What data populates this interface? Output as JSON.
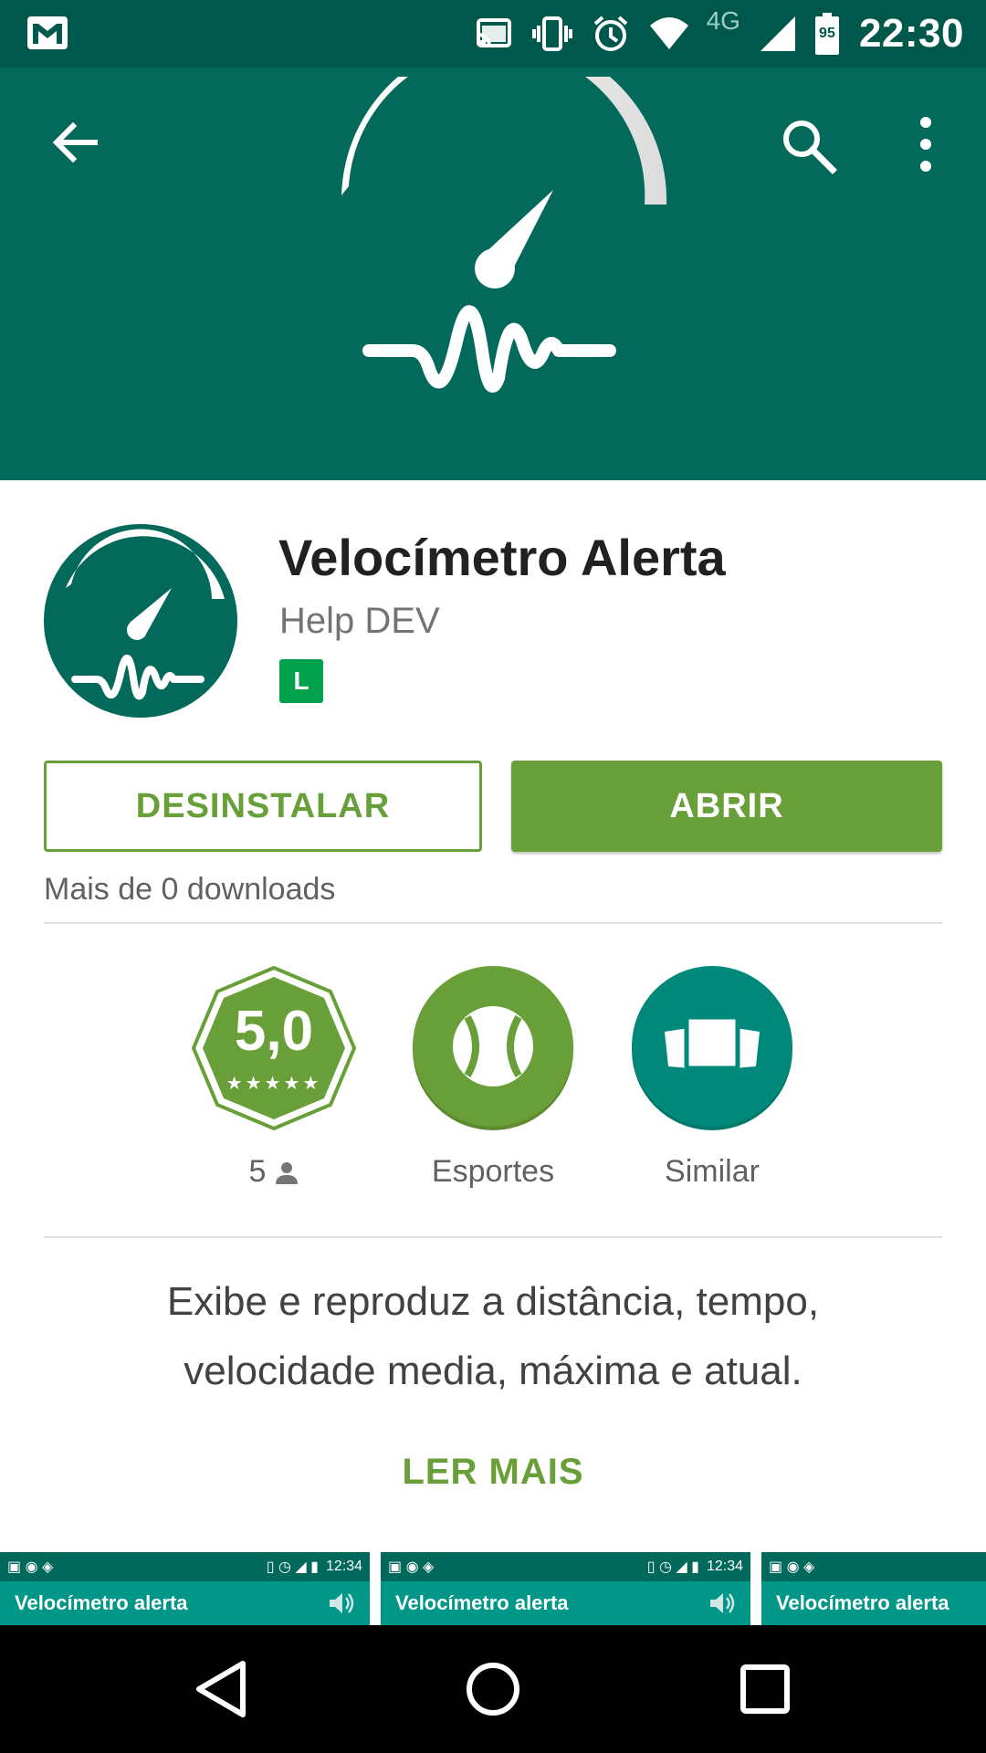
{
  "status_bar": {
    "time": "22:30",
    "network": "4G",
    "battery": "95"
  },
  "header": {
    "back_icon": "arrow-left-icon",
    "search_icon": "search-icon",
    "more_icon": "more-vert-icon"
  },
  "app": {
    "title": "Velocímetro Alerta",
    "developer": "Help DEV",
    "content_rating": "L"
  },
  "actions": {
    "uninstall_label": "DESINSTALAR",
    "open_label": "ABRIR"
  },
  "downloads": "Mais de 0 downloads",
  "badges": {
    "rating": {
      "value": "5,0",
      "count": "5",
      "stars": "★★★★★"
    },
    "category": {
      "label": "Esportes"
    },
    "similar": {
      "label": "Similar"
    }
  },
  "description": {
    "text": "Exibe e reproduz a distância, tempo, velocidade media, máxima e atual.",
    "read_more": "LER MAIS"
  },
  "screenshots": [
    {
      "status_time": "12:34",
      "title": "Velocímetro alerta"
    },
    {
      "status_time": "12:34",
      "title": "Velocímetro alerta"
    },
    {
      "status_time": "",
      "title": "Velocímetro alerta"
    }
  ],
  "colors": {
    "status_bar": "#00574b",
    "header": "#02695b",
    "accent_green": "#689f38",
    "teal": "#00897b"
  }
}
